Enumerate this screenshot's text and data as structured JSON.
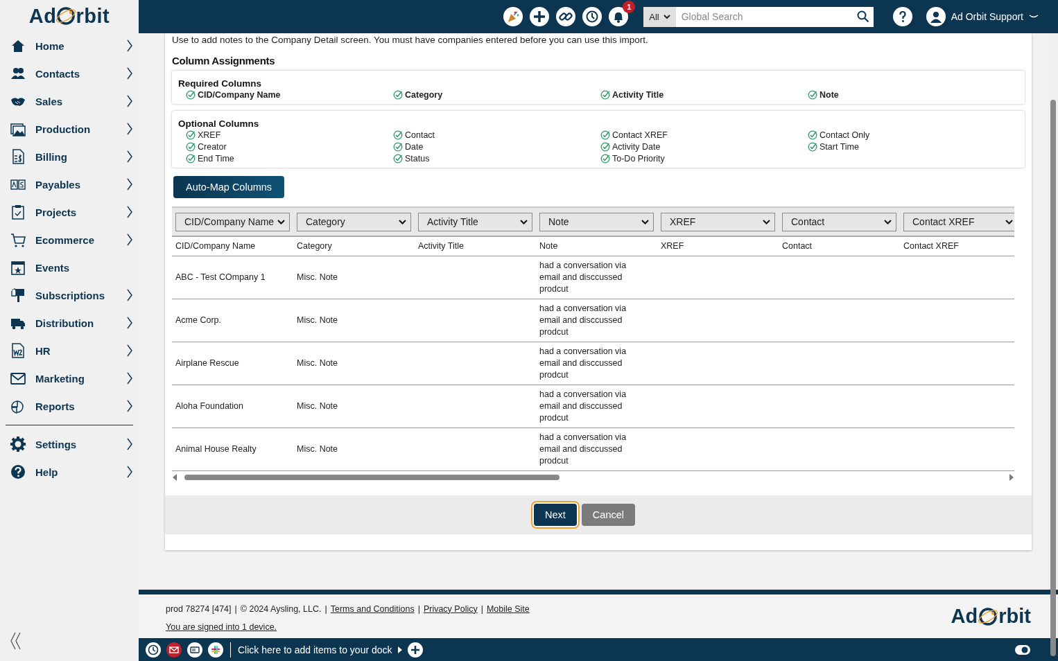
{
  "logo": {
    "left": "Ad",
    "right": "rbit"
  },
  "sidebar": {
    "items": [
      {
        "label": "Home",
        "has_submenu": true
      },
      {
        "label": "Contacts",
        "has_submenu": true
      },
      {
        "label": "Sales",
        "has_submenu": true
      },
      {
        "label": "Production",
        "has_submenu": true
      },
      {
        "label": "Billing",
        "has_submenu": true
      },
      {
        "label": "Payables",
        "has_submenu": true
      },
      {
        "label": "Projects",
        "has_submenu": true
      },
      {
        "label": "Ecommerce",
        "has_submenu": true
      },
      {
        "label": "Events",
        "has_submenu": false
      },
      {
        "label": "Subscriptions",
        "has_submenu": true
      },
      {
        "label": "Distribution",
        "has_submenu": true
      },
      {
        "label": "HR",
        "has_submenu": true
      },
      {
        "label": "Marketing",
        "has_submenu": true
      },
      {
        "label": "Reports",
        "has_submenu": true
      }
    ],
    "bottom_items": [
      {
        "label": "Settings",
        "has_submenu": true
      },
      {
        "label": "Help",
        "has_submenu": true
      }
    ]
  },
  "header": {
    "notification_count": "1",
    "search": {
      "scope": "All",
      "placeholder": "Global Search"
    },
    "user": "Ad Orbit Support"
  },
  "page": {
    "description": "Use to add notes to the Company Detail screen. You must have companies entered before you can use this import.",
    "section_title": "Column Assignments",
    "required": {
      "title": "Required Columns",
      "columns": [
        "CID/Company Name",
        "Category",
        "Activity Title",
        "Note"
      ]
    },
    "optional": {
      "title": "Optional Columns",
      "columns": [
        "XREF",
        "Contact",
        "Contact XREF",
        "Contact Only",
        "Creator",
        "Date",
        "Activity Date",
        "Start Time",
        "End Time",
        "Status",
        "To-Do Priority"
      ]
    },
    "automap_button": "Auto-Map Columns",
    "mappings": [
      "CID/Company Name",
      "Category",
      "Activity Title",
      "Note",
      "XREF",
      "Contact",
      "Contact XREF"
    ],
    "table": {
      "columns": [
        "CID/Company Name",
        "Category",
        "Activity Title",
        "Note",
        "XREF",
        "Contact",
        "Contact XREF"
      ],
      "rows": [
        {
          "company_name": "ABC - Test COmpany 1",
          "category": "Misc. Note",
          "note": "had a conversation via email and disccussed prodcut"
        },
        {
          "company_name": "Acme Corp.",
          "category": "Misc. Note",
          "note": "had a conversation via email and disccussed prodcut"
        },
        {
          "company_name": "Airplane Rescue",
          "category": "Misc. Note",
          "note": "had a conversation via email and disccussed prodcut"
        },
        {
          "company_name": "Aloha Foundation",
          "category": "Misc. Note",
          "note": "had a conversation via email and disccussed prodcut"
        },
        {
          "company_name": "Animal House Realty",
          "category": "Misc. Note",
          "note": "had a conversation via email and disccussed prodcut"
        }
      ]
    },
    "buttons": [
      {
        "label": "Next",
        "kind": "primary",
        "focused": true
      },
      {
        "label": "Cancel",
        "kind": "secondary",
        "focused": false
      }
    ]
  },
  "footer": {
    "items": [
      {
        "kind": "text",
        "text": "prod 78274 [474]"
      },
      {
        "kind": "separator",
        "text": "|"
      },
      {
        "kind": "text",
        "text": "© 2024 Aysling, LLC."
      },
      {
        "kind": "separator",
        "text": "|"
      },
      {
        "kind": "link",
        "text": "Terms and Conditions"
      },
      {
        "kind": "separator",
        "text": "|"
      },
      {
        "kind": "link",
        "text": "Privacy Policy"
      },
      {
        "kind": "separator",
        "text": "|"
      },
      {
        "kind": "link",
        "text": "Mobile Site"
      }
    ],
    "signed_in": "You are signed into 1 device.",
    "logo": {
      "left": "Ad",
      "right": "rbit"
    }
  },
  "dock": {
    "text": "Click here to add items to your dock"
  }
}
